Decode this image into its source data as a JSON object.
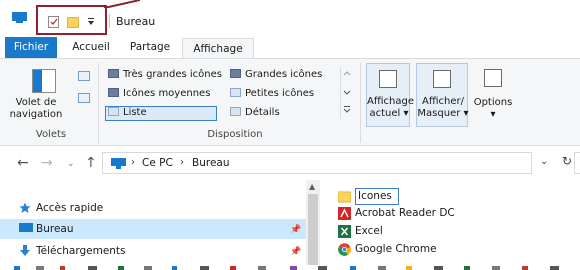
{
  "window": {
    "title": "Bureau"
  },
  "ribbon_tabs": {
    "file": "Fichier",
    "home": "Accueil",
    "share": "Partage",
    "view": "Affichage"
  },
  "panes_group": {
    "nav_pane_line1": "Volet de",
    "nav_pane_line2": "navigation",
    "label": "Volets"
  },
  "layout_group": {
    "options": [
      "Très grandes icônes",
      "Grandes icônes",
      "Icônes moyennes",
      "Petites icônes",
      "Liste",
      "Détails"
    ],
    "selected": "Liste",
    "label": "Disposition"
  },
  "view_buttons": {
    "current_view_line1": "Affichage",
    "current_view_line2": "actuel",
    "show_hide_line1": "Afficher/",
    "show_hide_line2": "Masquer",
    "options": "Options"
  },
  "address_bar": {
    "segment1": "Ce PC",
    "segment2": "Bureau"
  },
  "navigation_pane": {
    "items": [
      {
        "label": "Accès rapide",
        "icon": "star-icon"
      },
      {
        "label": "Bureau",
        "icon": "desktop-icon",
        "selected": true
      },
      {
        "label": "Téléchargements",
        "icon": "download-arrow-icon"
      }
    ]
  },
  "files": [
    {
      "name": "Icones",
      "icon": "folder-icon",
      "editing": true
    },
    {
      "name": "Acrobat Reader DC",
      "icon": "acrobat-icon"
    },
    {
      "name": "Excel",
      "icon": "excel-icon"
    },
    {
      "name": "Google Chrome",
      "icon": "chrome-icon"
    }
  ],
  "colors": {
    "accent": "#1979ca",
    "callout_border": "#8b2330",
    "selection": "#cce8ff",
    "folder": "#ffd35b"
  }
}
